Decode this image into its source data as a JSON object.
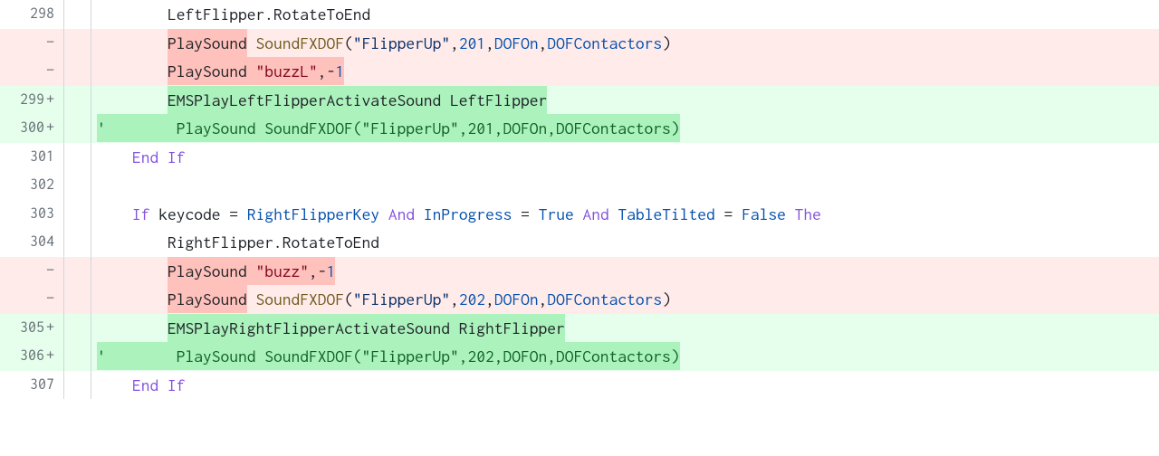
{
  "lines": [
    {
      "gutter": "298",
      "sign": "",
      "type": "context",
      "tokens": [
        {
          "t": "        LeftFlipper.RotateToEnd",
          "c": "tok-plain"
        }
      ]
    },
    {
      "gutter": "",
      "sign": "−",
      "type": "del",
      "tokens": [
        {
          "t": "        ",
          "c": "tok-plain"
        },
        {
          "t": "PlaySound",
          "c": "tok-plain",
          "hl": "del-strong"
        },
        {
          "t": " ",
          "c": "tok-plain"
        },
        {
          "t": "SoundFXDOF",
          "c": "tok-func"
        },
        {
          "t": "(",
          "c": "tok-paren"
        },
        {
          "t": "\"FlipperUp\"",
          "c": "tok-string"
        },
        {
          "t": ",",
          "c": "tok-plain"
        },
        {
          "t": "201",
          "c": "tok-number"
        },
        {
          "t": ",",
          "c": "tok-plain"
        },
        {
          "t": "DOFOn",
          "c": "tok-ident"
        },
        {
          "t": ",",
          "c": "tok-plain"
        },
        {
          "t": "DOFContactors",
          "c": "tok-ident"
        },
        {
          "t": ")",
          "c": "tok-paren"
        }
      ]
    },
    {
      "gutter": "",
      "sign": "−",
      "type": "del",
      "tokens": [
        {
          "t": "        ",
          "c": "tok-plain"
        },
        {
          "t": "PlaySound \"buzzL\",",
          "c": "tok-plain",
          "hl": "del-strong",
          "sub": [
            {
              "t": "PlaySound ",
              "c": "tok-plain"
            },
            {
              "t": "\"buzzL\"",
              "c": "tok-str-red"
            },
            {
              "t": ",",
              "c": "tok-plain"
            }
          ]
        },
        {
          "t": "-1",
          "c": "tok-comment",
          "hl": "del-strong",
          "sub": [
            {
              "t": "-",
              "c": "tok-plain"
            },
            {
              "t": "1",
              "c": "tok-number"
            }
          ]
        }
      ]
    },
    {
      "gutter": "299",
      "sign": "+",
      "type": "add",
      "tokens": [
        {
          "t": "        ",
          "c": "tok-plain"
        },
        {
          "t": "EMSPlayLeftFlipperActivateSound LeftFlipper",
          "c": "tok-plain",
          "hl": "add-strong"
        }
      ]
    },
    {
      "gutter": "300",
      "sign": "+",
      "type": "add",
      "tokens": [
        {
          "t": "'        PlaySound SoundFXDOF(\"FlipperUp\",201,DOFOn,DOFContactors)",
          "c": "tok-comment",
          "hl": "add-strong"
        }
      ]
    },
    {
      "gutter": "301",
      "sign": "",
      "type": "context",
      "tokens": [
        {
          "t": "    ",
          "c": "tok-plain"
        },
        {
          "t": "End",
          "c": "tok-keyword"
        },
        {
          "t": " ",
          "c": "tok-plain"
        },
        {
          "t": "If",
          "c": "tok-keyword"
        }
      ]
    },
    {
      "gutter": "302",
      "sign": "",
      "type": "context",
      "tokens": [
        {
          "t": "",
          "c": "tok-plain"
        }
      ]
    },
    {
      "gutter": "303",
      "sign": "",
      "type": "context",
      "tokens": [
        {
          "t": "    ",
          "c": "tok-plain"
        },
        {
          "t": "If",
          "c": "tok-keyword"
        },
        {
          "t": " keycode ",
          "c": "tok-plain"
        },
        {
          "t": "=",
          "c": "tok-op"
        },
        {
          "t": " ",
          "c": "tok-plain"
        },
        {
          "t": "RightFlipperKey",
          "c": "tok-ident"
        },
        {
          "t": " ",
          "c": "tok-plain"
        },
        {
          "t": "And",
          "c": "tok-keyword"
        },
        {
          "t": " ",
          "c": "tok-plain"
        },
        {
          "t": "InProgress",
          "c": "tok-ident"
        },
        {
          "t": " ",
          "c": "tok-plain"
        },
        {
          "t": "=",
          "c": "tok-op"
        },
        {
          "t": " ",
          "c": "tok-plain"
        },
        {
          "t": "True",
          "c": "tok-bool"
        },
        {
          "t": " ",
          "c": "tok-plain"
        },
        {
          "t": "And",
          "c": "tok-keyword"
        },
        {
          "t": " ",
          "c": "tok-plain"
        },
        {
          "t": "TableTilted",
          "c": "tok-ident"
        },
        {
          "t": " ",
          "c": "tok-plain"
        },
        {
          "t": "=",
          "c": "tok-op"
        },
        {
          "t": " ",
          "c": "tok-plain"
        },
        {
          "t": "False",
          "c": "tok-bool"
        },
        {
          "t": " ",
          "c": "tok-plain"
        },
        {
          "t": "The",
          "c": "tok-keyword"
        }
      ]
    },
    {
      "gutter": "304",
      "sign": "",
      "type": "context",
      "tokens": [
        {
          "t": "        RightFlipper.RotateToEnd",
          "c": "tok-plain"
        }
      ]
    },
    {
      "gutter": "",
      "sign": "−",
      "type": "del",
      "tokens": [
        {
          "t": "        ",
          "c": "tok-plain"
        },
        {
          "t": "PlaySound \"buzz\",",
          "c": "tok-plain",
          "hl": "del-strong",
          "sub": [
            {
              "t": "PlaySound ",
              "c": "tok-plain"
            },
            {
              "t": "\"buzz\"",
              "c": "tok-str-red"
            },
            {
              "t": ",",
              "c": "tok-plain"
            }
          ]
        },
        {
          "t": "-1",
          "c": "tok-plain",
          "hl": "del-strong",
          "sub": [
            {
              "t": "-",
              "c": "tok-plain"
            },
            {
              "t": "1",
              "c": "tok-number"
            }
          ]
        }
      ]
    },
    {
      "gutter": "",
      "sign": "−",
      "type": "del",
      "tokens": [
        {
          "t": "        ",
          "c": "tok-plain"
        },
        {
          "t": "PlaySound",
          "c": "tok-plain",
          "hl": "del-strong"
        },
        {
          "t": " ",
          "c": "tok-plain"
        },
        {
          "t": "SoundFXDOF",
          "c": "tok-func"
        },
        {
          "t": "(",
          "c": "tok-paren"
        },
        {
          "t": "\"FlipperUp\"",
          "c": "tok-string"
        },
        {
          "t": ",",
          "c": "tok-plain"
        },
        {
          "t": "202",
          "c": "tok-number"
        },
        {
          "t": ",",
          "c": "tok-plain"
        },
        {
          "t": "DOFOn",
          "c": "tok-ident"
        },
        {
          "t": ",",
          "c": "tok-plain"
        },
        {
          "t": "DOFContactors",
          "c": "tok-ident"
        },
        {
          "t": ")",
          "c": "tok-paren"
        }
      ]
    },
    {
      "gutter": "305",
      "sign": "+",
      "type": "add",
      "tokens": [
        {
          "t": "        ",
          "c": "tok-plain"
        },
        {
          "t": "EMSPlayRightFlipperActivateSound RightFlipper",
          "c": "tok-plain",
          "hl": "add-strong"
        }
      ]
    },
    {
      "gutter": "306",
      "sign": "+",
      "type": "add",
      "tokens": [
        {
          "t": "'        PlaySound SoundFXDOF(\"FlipperUp\",202,DOFOn,DOFContactors)",
          "c": "tok-comment",
          "hl": "add-strong"
        }
      ]
    },
    {
      "gutter": "307",
      "sign": "",
      "type": "context",
      "tokens": [
        {
          "t": "    ",
          "c": "tok-plain"
        },
        {
          "t": "End",
          "c": "tok-keyword"
        },
        {
          "t": " ",
          "c": "tok-plain"
        },
        {
          "t": "If",
          "c": "tok-keyword"
        }
      ]
    }
  ]
}
